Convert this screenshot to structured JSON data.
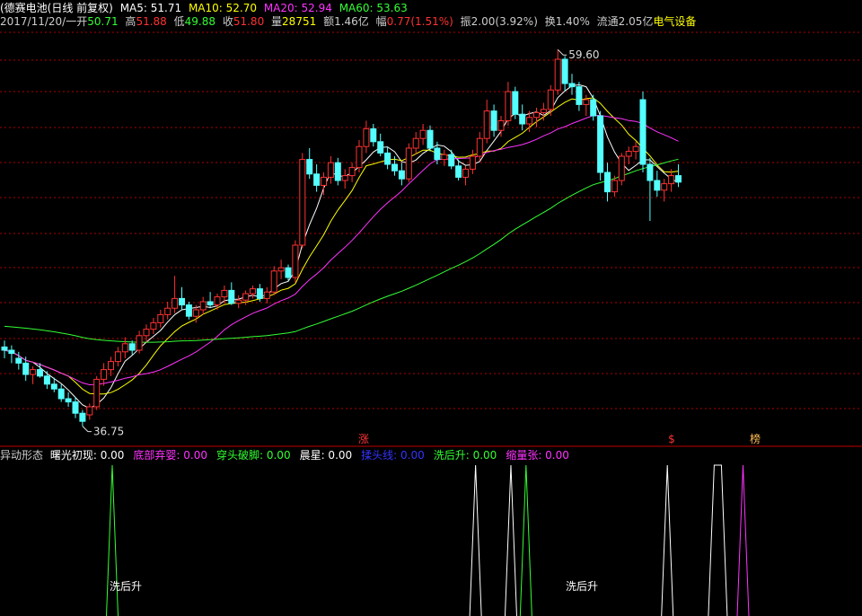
{
  "header": {
    "stock_name": "(德赛电池(日线 前复权)",
    "ma5_label": "MA5: 51.71",
    "ma10_label": "MA10: 52.70",
    "ma20_label": "MA20: 52.94",
    "ma60_label": "MA60: 53.63",
    "date": "2017/11/20/一",
    "open_label": "开",
    "open_value": "50.71",
    "high_label": "高",
    "high_value": "51.88",
    "low_label": "低",
    "low_value": "49.88",
    "close_label": "收",
    "close_value": "51.80",
    "volume_label": "量",
    "volume_value": "28751",
    "amount_label": "额1.46亿",
    "change_label": "幅",
    "change_value": "0.77(1.51%)",
    "amplitude": "振2.00(3.92%)",
    "turnover": "换1.40%",
    "float_cap": "流通2.05亿",
    "sector": "电气设备"
  },
  "indicator": {
    "name": "异动形态",
    "items": [
      {
        "label": "曙光初现:",
        "value": "0.00",
        "color": "#ffffff"
      },
      {
        "label": "底部弃婴:",
        "value": "0.00",
        "color": "#ff33ff"
      },
      {
        "label": "穿头破脚:",
        "value": "0.00",
        "color": "#33ff33"
      },
      {
        "label": "晨星:",
        "value": "0.00",
        "color": "#ffffff"
      },
      {
        "label": "揉头线:",
        "value": "0.00",
        "color": "#3333ff"
      },
      {
        "label": "洗后升:",
        "value": "0.00",
        "color": "#33ff33"
      },
      {
        "label": "缩量张:",
        "value": "0.00",
        "color": "#ff33ff"
      }
    ],
    "signal_labels": [
      "洗后升",
      "洗后升"
    ]
  },
  "markers": {
    "zhang": "涨",
    "dollar": "$",
    "bang": "榜"
  },
  "annotations": {
    "high_price": "59.60",
    "low_price": "36.75"
  },
  "colors": {
    "up": "#ff3232",
    "down": "#54ffff",
    "ma5": "#ffffff",
    "ma10": "#ffff00",
    "ma20": "#ff33ff",
    "ma60": "#33ff33",
    "grid": "#b00000"
  },
  "chart_data": {
    "type": "candlestick",
    "ylim": [
      36,
      61
    ],
    "candles": [
      [
        41.2,
        41.6,
        40.5,
        41.0
      ],
      [
        41.0,
        41.3,
        40.2,
        40.8
      ],
      [
        40.5,
        40.9,
        39.8,
        40.2
      ],
      [
        40.2,
        40.6,
        39.1,
        39.5
      ],
      [
        39.5,
        40.0,
        38.9,
        39.8
      ],
      [
        39.8,
        40.2,
        39.3,
        39.4
      ],
      [
        39.4,
        39.7,
        38.6,
        38.9
      ],
      [
        38.9,
        39.3,
        38.4,
        38.6
      ],
      [
        38.6,
        38.9,
        37.8,
        38.0
      ],
      [
        38.0,
        38.4,
        37.5,
        37.8
      ],
      [
        37.8,
        38.1,
        36.8,
        37.1
      ],
      [
        37.1,
        37.3,
        36.3,
        36.6
      ],
      [
        37.0,
        37.7,
        36.7,
        37.5
      ],
      [
        37.5,
        39.4,
        37.3,
        39.2
      ],
      [
        39.2,
        40.2,
        38.8,
        39.8
      ],
      [
        39.8,
        40.6,
        39.4,
        40.3
      ],
      [
        40.3,
        41.2,
        40.0,
        40.9
      ],
      [
        40.9,
        41.8,
        40.5,
        41.4
      ],
      [
        41.4,
        41.6,
        40.7,
        41.0
      ],
      [
        41.0,
        42.2,
        40.8,
        41.9
      ],
      [
        41.9,
        42.6,
        41.5,
        42.3
      ],
      [
        42.3,
        43.0,
        42.0,
        42.7
      ],
      [
        42.7,
        43.5,
        42.4,
        43.2
      ],
      [
        43.2,
        44.0,
        42.9,
        43.6
      ],
      [
        43.6,
        45.6,
        43.3,
        44.2
      ],
      [
        44.2,
        44.9,
        43.5,
        43.8
      ],
      [
        43.8,
        44.0,
        42.9,
        43.1
      ],
      [
        43.1,
        43.8,
        42.7,
        43.5
      ],
      [
        43.5,
        44.3,
        43.2,
        44.0
      ],
      [
        44.0,
        44.6,
        43.6,
        43.8
      ],
      [
        43.8,
        44.5,
        43.5,
        44.3
      ],
      [
        44.3,
        45.0,
        43.9,
        44.7
      ],
      [
        44.7,
        45.2,
        43.8,
        43.9
      ],
      [
        43.9,
        44.4,
        43.6,
        44.1
      ],
      [
        44.1,
        44.7,
        43.8,
        44.5
      ],
      [
        44.5,
        45.0,
        44.2,
        44.8
      ],
      [
        44.8,
        45.1,
        44.0,
        44.2
      ],
      [
        44.2,
        44.9,
        43.9,
        44.6
      ],
      [
        44.6,
        46.2,
        44.4,
        45.9
      ],
      [
        45.9,
        46.6,
        45.4,
        46.1
      ],
      [
        46.1,
        46.3,
        45.3,
        45.5
      ],
      [
        45.5,
        47.8,
        45.2,
        47.5
      ],
      [
        47.5,
        53.2,
        47.3,
        52.8
      ],
      [
        52.8,
        53.5,
        51.6,
        51.9
      ],
      [
        51.9,
        52.5,
        50.8,
        51.2
      ],
      [
        51.2,
        52.0,
        50.6,
        51.7
      ],
      [
        51.7,
        53.0,
        51.3,
        52.6
      ],
      [
        52.6,
        52.9,
        51.2,
        51.5
      ],
      [
        51.5,
        52.2,
        51.0,
        51.8
      ],
      [
        51.8,
        52.6,
        51.4,
        52.3
      ],
      [
        52.3,
        54.0,
        52.0,
        53.6
      ],
      [
        53.6,
        55.2,
        53.2,
        54.7
      ],
      [
        54.7,
        55.0,
        53.6,
        53.9
      ],
      [
        53.9,
        54.4,
        53.0,
        53.2
      ],
      [
        53.2,
        53.6,
        52.2,
        52.5
      ],
      [
        52.5,
        53.0,
        51.8,
        52.1
      ],
      [
        52.1,
        52.6,
        51.2,
        51.6
      ],
      [
        51.6,
        53.8,
        51.4,
        53.5
      ],
      [
        53.5,
        54.5,
        53.1,
        54.1
      ],
      [
        54.1,
        55.0,
        53.7,
        54.6
      ],
      [
        54.6,
        54.9,
        53.3,
        53.5
      ],
      [
        53.5,
        53.9,
        52.5,
        52.8
      ],
      [
        52.8,
        53.4,
        52.4,
        53.1
      ],
      [
        53.1,
        53.4,
        52.2,
        52.4
      ],
      [
        52.4,
        52.8,
        51.5,
        51.7
      ],
      [
        51.7,
        52.4,
        51.2,
        52.2
      ],
      [
        52.2,
        53.4,
        51.9,
        53.0
      ],
      [
        53.0,
        54.5,
        52.7,
        54.1
      ],
      [
        54.1,
        56.5,
        53.8,
        55.8
      ],
      [
        55.8,
        56.2,
        54.2,
        54.6
      ],
      [
        54.6,
        55.5,
        54.2,
        55.2
      ],
      [
        55.2,
        57.6,
        54.9,
        57.0
      ],
      [
        57.0,
        57.3,
        55.3,
        55.6
      ],
      [
        55.6,
        56.2,
        54.6,
        55.0
      ],
      [
        55.0,
        55.8,
        54.5,
        55.4
      ],
      [
        55.4,
        56.0,
        54.8,
        55.7
      ],
      [
        55.7,
        56.3,
        55.2,
        55.9
      ],
      [
        55.9,
        57.4,
        55.5,
        57.1
      ],
      [
        57.1,
        59.6,
        56.8,
        59.0
      ],
      [
        59.0,
        59.2,
        57.0,
        57.5
      ],
      [
        57.5,
        58.1,
        56.8,
        57.3
      ],
      [
        57.3,
        57.6,
        55.8,
        56.2
      ],
      [
        56.2,
        56.8,
        55.5,
        56.5
      ],
      [
        56.5,
        56.8,
        55.2,
        55.5
      ],
      [
        55.5,
        55.8,
        51.5,
        52.0
      ],
      [
        52.0,
        52.6,
        50.2,
        50.8
      ],
      [
        50.8,
        51.8,
        50.5,
        51.5
      ],
      [
        51.5,
        53.2,
        51.2,
        53.0
      ],
      [
        53.0,
        53.6,
        52.5,
        53.3
      ],
      [
        53.3,
        53.9,
        52.8,
        53.6
      ],
      [
        56.5,
        57.0,
        52.0,
        52.5
      ],
      [
        52.5,
        52.9,
        49.0,
        51.5
      ],
      [
        51.5,
        52.1,
        50.5,
        50.9
      ],
      [
        50.9,
        51.6,
        50.2,
        51.3
      ],
      [
        51.3,
        52.2,
        50.8,
        51.8
      ],
      [
        51.8,
        52.5,
        51.1,
        51.4
      ]
    ],
    "ma_periods": [
      5,
      10,
      20,
      60
    ],
    "ma_names": [
      "MA5",
      "MA10",
      "MA20",
      "MA60"
    ],
    "high_index": 78,
    "low_index": 11,
    "marker_indices": [
      60,
      73,
      83
    ],
    "signals": [
      {
        "index": 19,
        "color": "#33ff33",
        "flat": false
      },
      {
        "index": 91,
        "color": "#ffffff",
        "flat": false
      },
      {
        "index": 98,
        "color": "#ffffff",
        "flat": false
      },
      {
        "index": 101,
        "color": "#33ff33",
        "flat": false
      },
      {
        "index": 129,
        "color": "#ffffff",
        "flat": false
      },
      {
        "index": 139,
        "color": "#ffffff",
        "flat": true
      },
      {
        "index": 144,
        "color": "#ff33ff",
        "flat": false
      }
    ]
  }
}
